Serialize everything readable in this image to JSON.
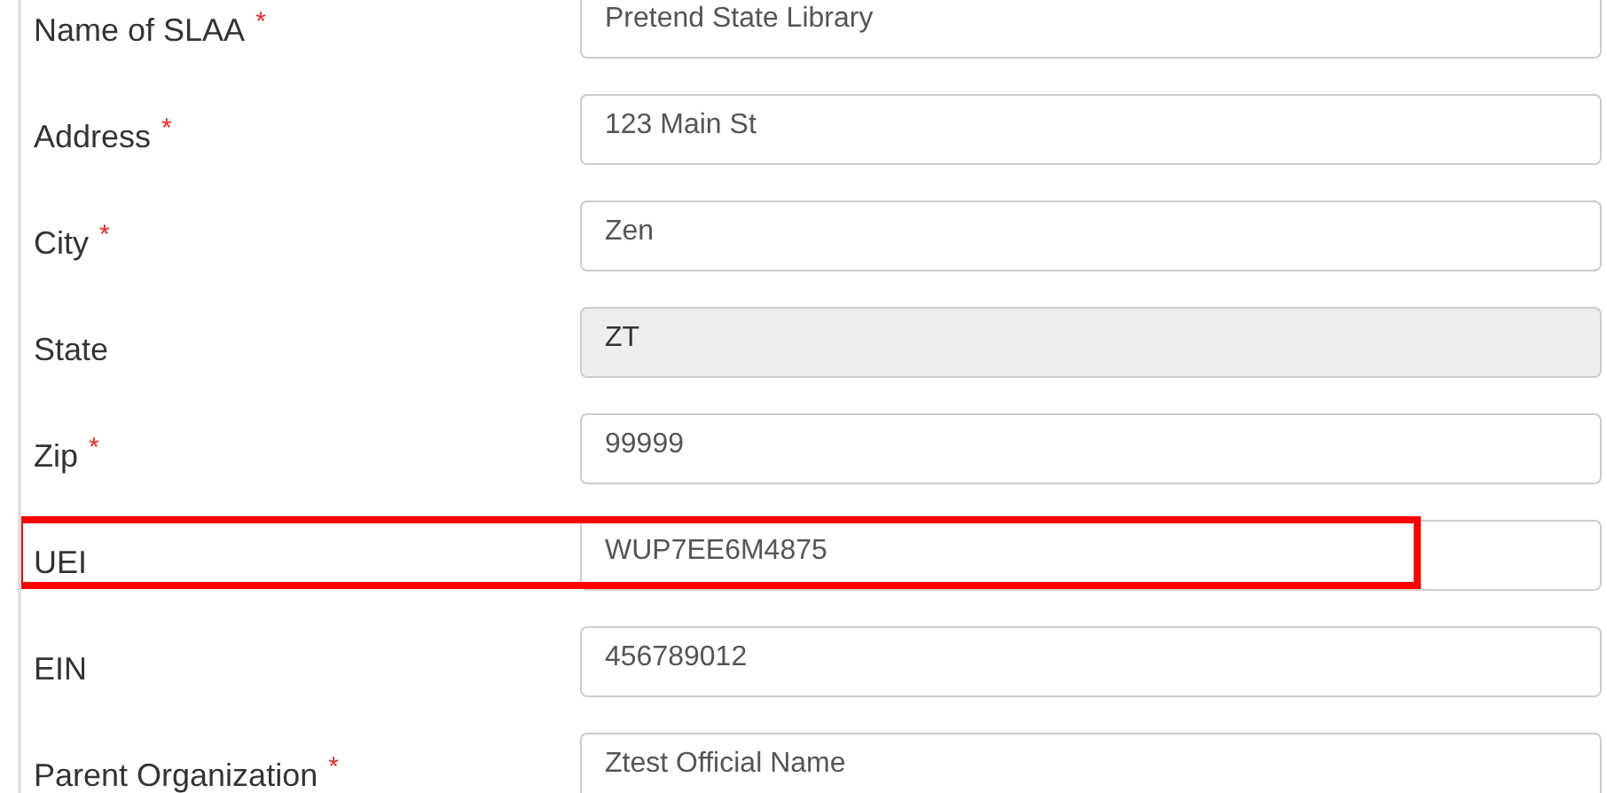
{
  "fields": [
    {
      "label": "Name of SLAA",
      "mark": "*",
      "value": "Pretend State Library",
      "disabled": false,
      "highlighted": false
    },
    {
      "label": "Address",
      "mark": "*",
      "value": "123 Main St",
      "disabled": false,
      "highlighted": false
    },
    {
      "label": "City",
      "mark": "*",
      "value": "Zen",
      "disabled": false,
      "highlighted": false
    },
    {
      "label": "State",
      "value": "ZT",
      "disabled": true,
      "highlighted": false
    },
    {
      "label": "Zip",
      "mark": "*",
      "value": "99999",
      "disabled": false,
      "highlighted": false
    },
    {
      "label": "UEI",
      "value": "WUP7EE6M4875",
      "disabled": false,
      "highlighted": true
    },
    {
      "label": "EIN",
      "value": "456789012",
      "disabled": false,
      "highlighted": false
    },
    {
      "label": "Parent Organization",
      "mark": "*",
      "value": "Ztest Official Name",
      "disabled": false,
      "highlighted": false
    }
  ]
}
